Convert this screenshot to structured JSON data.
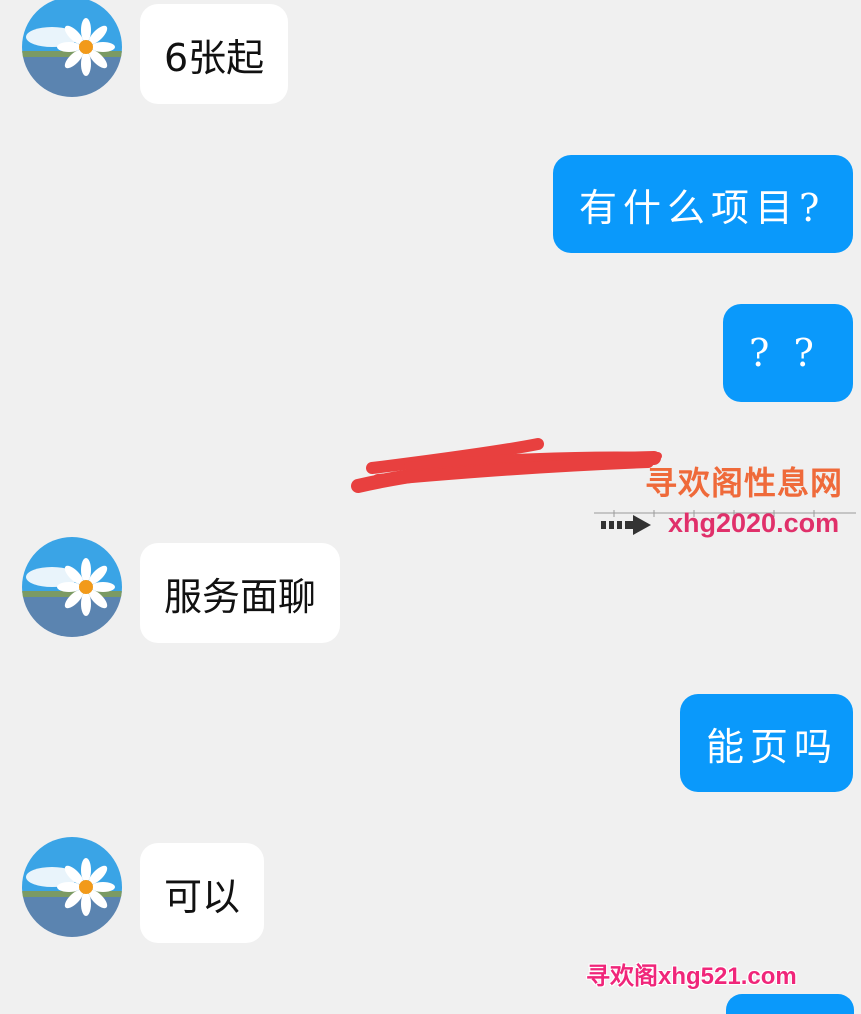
{
  "messages": [
    {
      "side": "in",
      "text": "6张起"
    },
    {
      "side": "out",
      "text": "有什么项目?"
    },
    {
      "side": "out",
      "text": "? ?"
    },
    {
      "side": "in",
      "text": "服务面聊"
    },
    {
      "side": "out",
      "text": "能页吗"
    },
    {
      "side": "in",
      "text": "可以"
    }
  ],
  "watermarks": {
    "site_name": "寻欢阁性息网",
    "site_url": "xhg2020.com",
    "footer": "寻欢阁xhg521.com"
  },
  "colors": {
    "background": "#f0f0f0",
    "incoming_bubble": "#ffffff",
    "outgoing_bubble": "#0a99fb",
    "redaction": "#e8403f"
  },
  "icons": {
    "avatar": "daisy-flower-avatar-icon",
    "arrow": "right-arrow-icon"
  }
}
